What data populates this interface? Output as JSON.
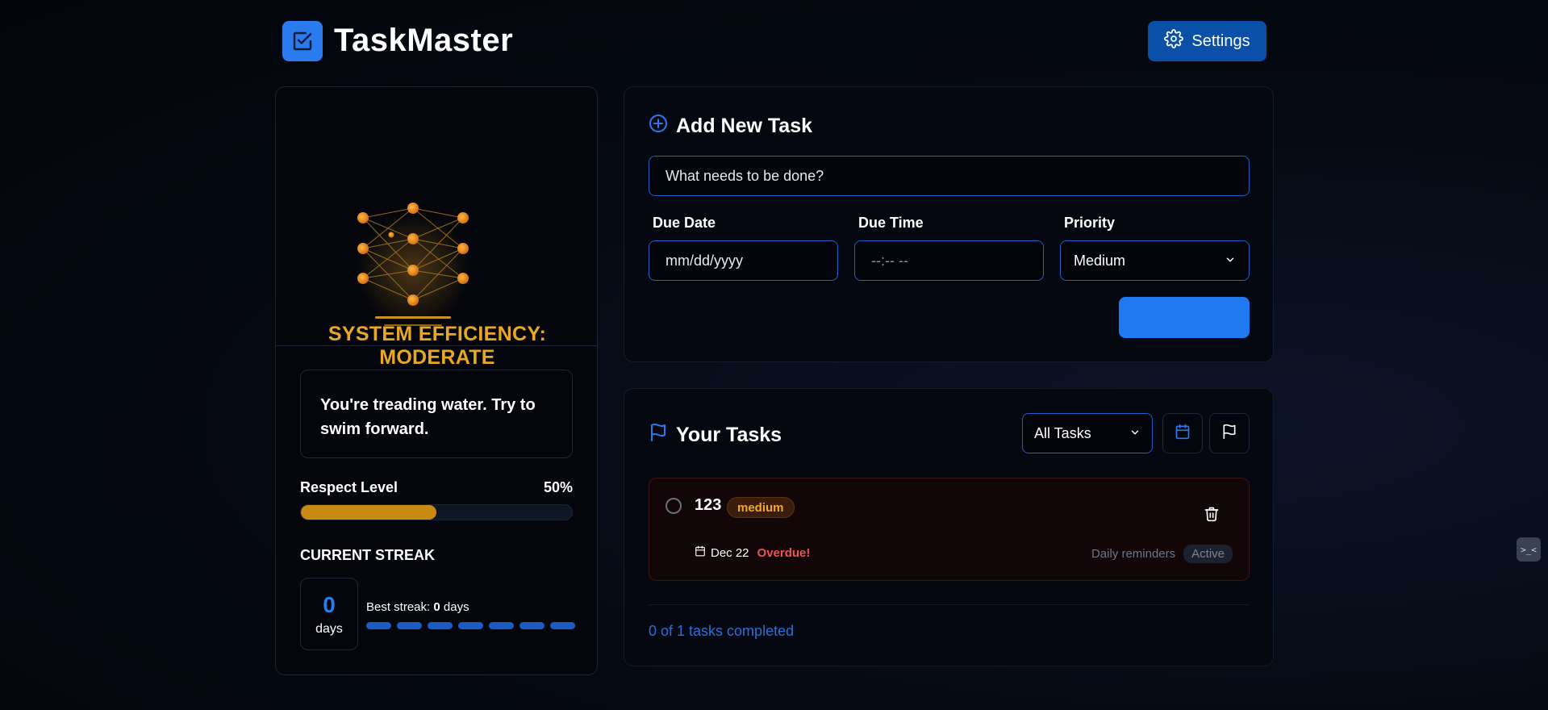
{
  "header": {
    "app_title": "TaskMaster",
    "settings_label": "Settings"
  },
  "status": {
    "efficiency_text": "SYSTEM EFFICIENCY: MODERATE",
    "quote": "You're treading water. Try to swim forward.",
    "respect_label": "Respect Level",
    "respect_value": "50%",
    "respect_fraction": 0.5,
    "streak_title": "CURRENT STREAK",
    "streak_count": "0",
    "streak_unit": "days",
    "best_streak_label": "Best streak:",
    "best_streak_value": "0",
    "best_streak_unit": "days",
    "streak_dots": 7
  },
  "add_task": {
    "title": "Add New Task",
    "input_placeholder": "What needs to be done?",
    "due_date_label": "Due Date",
    "due_date_placeholder": "mm/dd/yyyy",
    "due_time_label": "Due Time",
    "due_time_placeholder": "--:-- --",
    "priority_label": "Priority",
    "priority_value": "Medium",
    "add_button_label": ""
  },
  "tasks": {
    "title": "Your Tasks",
    "filter_value": "All Tasks",
    "items": [
      {
        "name": "123",
        "priority": "medium",
        "date": "Dec 22",
        "overdue": "Overdue!",
        "reminder_label": "Daily reminders",
        "reminder_status": "Active"
      }
    ],
    "summary": "0 of 1 tasks completed"
  },
  "widget": {
    "label": ">_<"
  },
  "colors": {
    "accent": "#1f7af2",
    "warning": "#e8a824",
    "danger": "#f05252"
  },
  "icons": {
    "logo": "checkbox-icon",
    "settings": "gear-icon",
    "add_task": "plus-circle-icon",
    "tasks": "flag-icon",
    "calendar": "calendar-icon",
    "delete": "trash-icon"
  }
}
